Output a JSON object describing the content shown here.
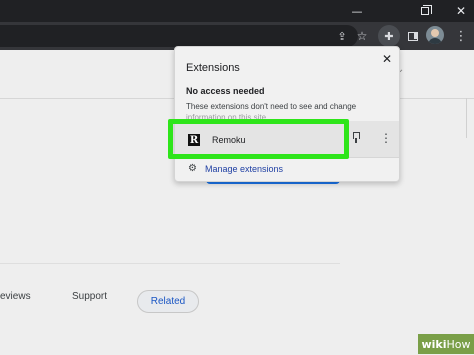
{
  "window": {
    "minimize_glyph": "—",
    "close_glyph": "✕"
  },
  "toolbar": {
    "icons": [
      "share-icon",
      "star-icon",
      "extensions-puzzle-icon",
      "side-panel-icon",
      "profile-avatar",
      "kebab-menu-icon"
    ],
    "share_glyph": "⇪",
    "star_glyph": "☆",
    "extensions_glyph": "✚",
    "kebab_glyph": "⋮"
  },
  "extensions_popup": {
    "title": "Extensions",
    "close_glyph": "✕",
    "section_header": "No access needed",
    "description": "These extensions don't need to see and change",
    "description_cont": "information on this site",
    "items": [
      {
        "name": "Remoku",
        "logo_letter": "R",
        "kebab_glyph": "⋮"
      }
    ],
    "manage_icon_glyph": "⚙",
    "manage_label": "Manage extensions"
  },
  "page": {
    "chevron_glyph": "⌄",
    "tabs": [
      "eviews",
      "Support",
      "Related"
    ]
  },
  "highlight_color": "#2ee51a",
  "watermark": {
    "brand_bold": "wiki",
    "brand_regular": "How"
  }
}
